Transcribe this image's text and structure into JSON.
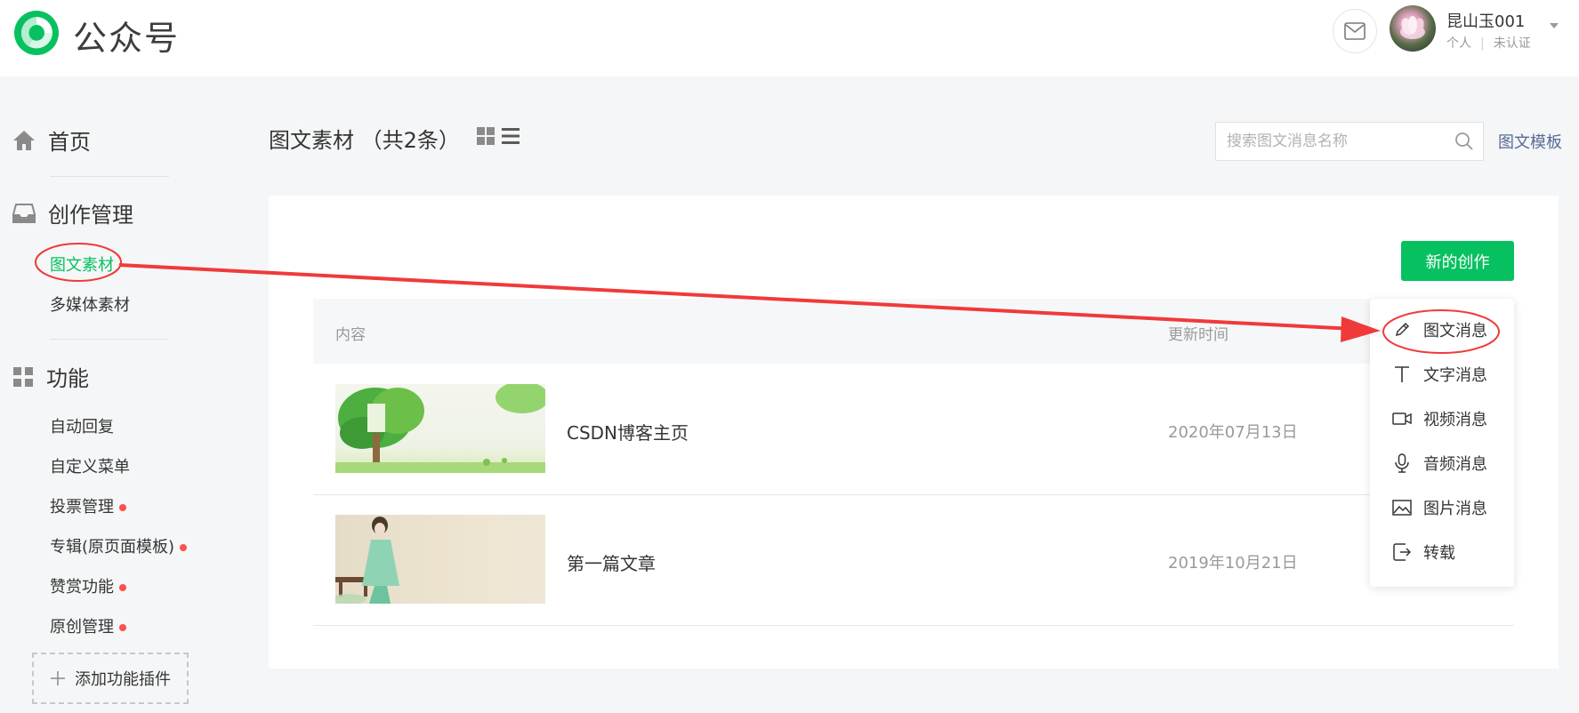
{
  "header": {
    "brand": "公众号",
    "user_name": "昆山玉001",
    "user_type": "个人",
    "user_status": "未认证"
  },
  "sidebar": {
    "home": "首页",
    "creation": "创作管理",
    "creation_items": [
      {
        "label": "图文素材",
        "active": true
      },
      {
        "label": "多媒体素材",
        "active": false
      }
    ],
    "features": "功能",
    "feature_items": [
      {
        "label": "自动回复",
        "dot": false
      },
      {
        "label": "自定义菜单",
        "dot": false
      },
      {
        "label": "投票管理",
        "dot": true
      },
      {
        "label": "专辑(原页面模板)",
        "dot": true
      },
      {
        "label": "赞赏功能",
        "dot": true
      },
      {
        "label": "原创管理",
        "dot": true
      }
    ],
    "add_plugin": "添加功能插件"
  },
  "main": {
    "title": "图文素材 （共2条）",
    "search_placeholder": "搜索图文消息名称",
    "template_link": "图文模板",
    "new_button": "新的创作",
    "table": {
      "columns": [
        "内容",
        "更新时间"
      ],
      "rows": [
        {
          "title": "CSDN博客主页",
          "time": "2020年07月13日"
        },
        {
          "title": "第一篇文章",
          "time": "2019年10月21日"
        }
      ]
    }
  },
  "dropdown": {
    "items": [
      {
        "label": "图文消息",
        "icon": "pencil-icon"
      },
      {
        "label": "文字消息",
        "icon": "text-icon"
      },
      {
        "label": "视频消息",
        "icon": "video-icon"
      },
      {
        "label": "音频消息",
        "icon": "microphone-icon"
      },
      {
        "label": "图片消息",
        "icon": "image-icon"
      },
      {
        "label": "转载",
        "icon": "repost-icon"
      }
    ]
  },
  "colors": {
    "accent": "#07c160",
    "link": "#576b95",
    "annotation": "#f03a3a",
    "badge_dot": "#fa5151"
  }
}
